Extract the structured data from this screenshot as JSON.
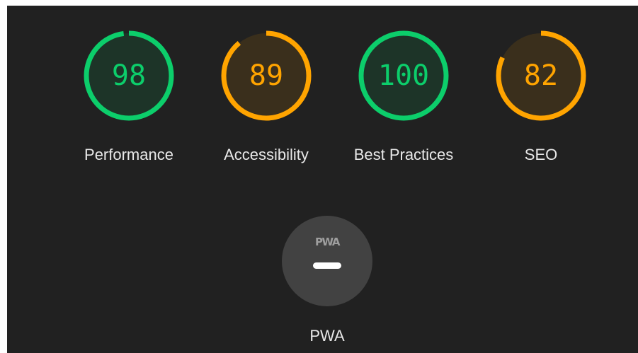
{
  "gauges": [
    {
      "label": "Performance",
      "score": "98",
      "value": 98,
      "color": "#0cce6b",
      "fill": "#1d3428"
    },
    {
      "label": "Accessibility",
      "score": "89",
      "value": 89,
      "color": "#ffa400",
      "fill": "#3a2f1c"
    },
    {
      "label": "Best Practices",
      "score": "100",
      "value": 100,
      "color": "#0cce6b",
      "fill": "#1d3428"
    },
    {
      "label": "SEO",
      "score": "82",
      "value": 82,
      "color": "#ffa400",
      "fill": "#3a2f1c"
    }
  ],
  "pwa": {
    "badge_text": "PWA",
    "label": "PWA",
    "state_icon": "dash-icon",
    "badge_color": "#424242"
  },
  "theme": {
    "panel_background": "#212121",
    "label_color": "#e8e8e8"
  }
}
